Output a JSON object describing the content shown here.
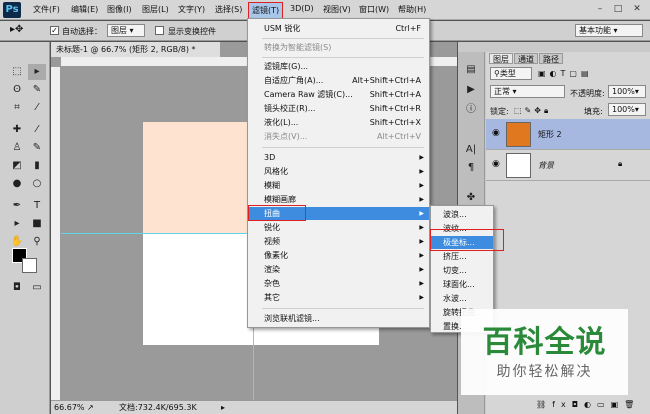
{
  "app": {
    "logo": "Ps"
  },
  "menubar": {
    "items": [
      "文件(F)",
      "编辑(E)",
      "图像(I)",
      "图层(L)",
      "文字(Y)",
      "选择(S)",
      "滤镜(T)",
      "3D(D)",
      "视图(V)",
      "窗口(W)",
      "帮助(H)"
    ],
    "active": "滤镜(T)"
  },
  "optbar": {
    "auto_select": "自动选择：",
    "auto_select_value": "图层",
    "show_transform": "显示变换控件",
    "workspace": "基本功能"
  },
  "document": {
    "tab": "未标题-1 @ 66.7% (矩形 2, RGB/8) *",
    "zoom": "66.67%",
    "doc_size": "文档:732.4K/695.3K"
  },
  "filter_menu": {
    "top_item": "USM 锐化",
    "top_shortcut": "Ctrl+F",
    "smart": "转换为智能滤镜(S)",
    "gallery": "滤镜库(G)...",
    "adaptive": "自适应广角(A)...",
    "adaptive_sc": "Alt+Shift+Ctrl+A",
    "camera_raw": "Camera Raw 滤镜(C)...",
    "camera_raw_sc": "Shift+Ctrl+A",
    "lens": "镜头校正(R)...",
    "lens_sc": "Shift+Ctrl+R",
    "liquify": "液化(L)...",
    "liquify_sc": "Shift+Ctrl+X",
    "vanish": "消失点(V)...",
    "vanish_sc": "Alt+Ctrl+V",
    "groups": [
      "3D",
      "风格化",
      "模糊",
      "模糊画廊",
      "扭曲",
      "锐化",
      "视频",
      "像素化",
      "渲染",
      "杂色",
      "其它"
    ],
    "active_group": "扭曲",
    "browse": "浏览联机滤镜..."
  },
  "distort_submenu": {
    "items": [
      "波浪...",
      "波纹...",
      "极坐标...",
      "挤压...",
      "切变...",
      "球面化...",
      "水波...",
      "旋转扭曲...",
      "置换..."
    ],
    "active": "极坐标..."
  },
  "panel": {
    "tabs": [
      "图层",
      "通道",
      "路径"
    ],
    "kind": "类型",
    "blend_mode": "正常",
    "opacity_label": "不透明度:",
    "opacity": "100%",
    "lock_label": "锁定:",
    "fill_label": "填充:",
    "fill": "100%",
    "layers": [
      "矩形 2",
      "背景"
    ]
  },
  "watermark": {
    "title": "百科全说",
    "subtitle": "助你轻松解决"
  },
  "colors": {
    "accent": "#3e8ce0",
    "highlight_box": "#e02020",
    "shape_fill": "#fde3d0",
    "layer_swatch": "#e07820"
  }
}
